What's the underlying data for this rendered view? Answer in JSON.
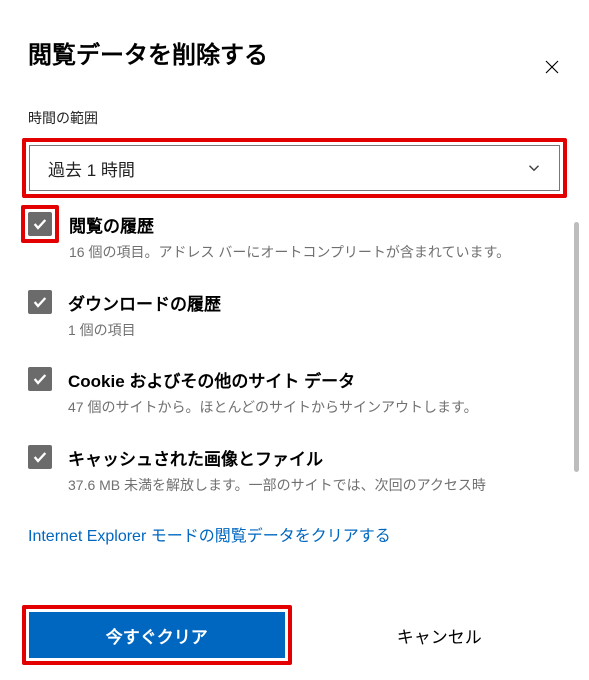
{
  "dialog": {
    "title": "閲覧データを削除する",
    "time_range_label": "時間の範囲",
    "time_range_value": "過去 1 時間",
    "link_text": "Internet Explorer モードの閲覧データをクリアする",
    "clear_button": "今すぐクリア",
    "cancel_button": "キャンセル"
  },
  "items": [
    {
      "title": "閲覧の履歴",
      "desc": "16 個の項目。アドレス バーにオートコンプリートが含まれています。",
      "highlighted": true
    },
    {
      "title": "ダウンロードの履歴",
      "desc": "1 個の項目",
      "highlighted": false
    },
    {
      "title": "Cookie およびその他のサイト データ",
      "desc": "47 個のサイトから。ほとんどのサイトからサインアウトします。",
      "highlighted": false
    },
    {
      "title": "キャッシュされた画像とファイル",
      "desc": "37.6 MB 未満を解放します。一部のサイトでは、次回のアクセス時",
      "highlighted": false
    }
  ]
}
